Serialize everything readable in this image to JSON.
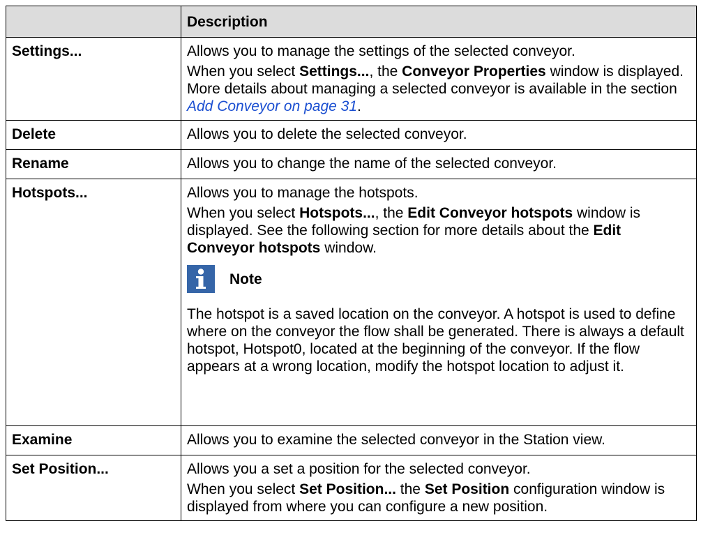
{
  "table": {
    "header": {
      "col1": "",
      "col2": "Description"
    },
    "rows": [
      {
        "term": "Settings...",
        "p1": "Allows you to manage the settings of the selected conveyor.",
        "p2": {
          "t1": "When you select ",
          "b1": "Settings...",
          "t2": ", the ",
          "b2": "Conveyor Properties",
          "t3": " window is displayed. More details about managing a selected conveyor is available in the section ",
          "link": "Add Conveyor on page 31",
          "t4": "."
        }
      },
      {
        "term": "Delete",
        "p1": "Allows you to delete the selected conveyor."
      },
      {
        "term": "Rename",
        "p1": "Allows you to change the name of the selected conveyor."
      },
      {
        "term": "Hotspots...",
        "p1": "Allows you to manage the hotspots.",
        "p2": {
          "t1": "When you select ",
          "b1": "Hotspots...",
          "t2": ", the ",
          "b2": "Edit Conveyor hotspots",
          "t3": " window is displayed. See the following section for more details about the ",
          "b3": "Edit Conveyor hotspots",
          "t4": " window."
        },
        "note": {
          "icon": "info-icon",
          "label": "Note",
          "text": "The hotspot is a saved location on the conveyor. A hotspot is used to define where on the conveyor the flow shall be generated. There is always a default hotspot, Hotspot0, located at the beginning of the conveyor. If the flow appears at a wrong location, modify the hotspot location to adjust it."
        }
      },
      {
        "term": "Examine",
        "p1": "Allows you to examine the selected conveyor in the Station view."
      },
      {
        "term": "Set Position...",
        "p1": "Allows you a set a position for the selected conveyor.",
        "p2": {
          "t1": "When you select ",
          "b1": "Set Position...",
          "t2": " the ",
          "b2": "Set Position",
          "t3": " configuration window is displayed from where you can configure a new position."
        }
      }
    ]
  },
  "colors": {
    "header_bg": "#dcdcdc",
    "link": "#1b4fd1",
    "note_icon_bg": "#3565a8"
  }
}
